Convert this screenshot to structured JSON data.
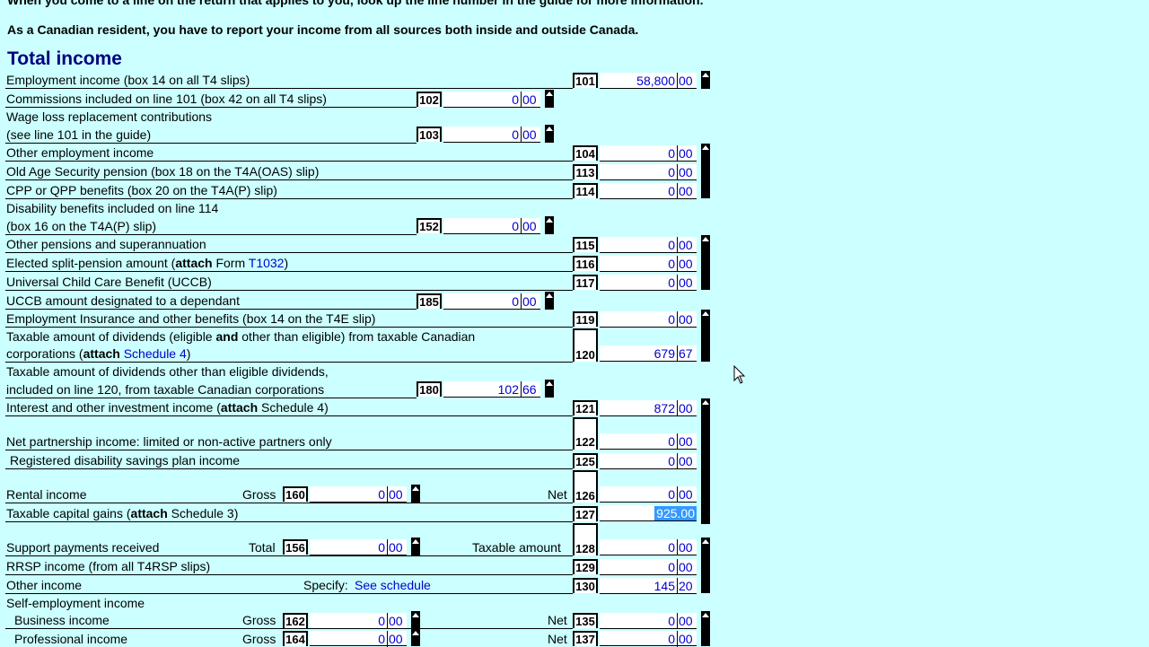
{
  "instructions": {
    "top_partial": "When you come to a line on the return that applies to you, look up the line number in the guide for more information.",
    "resident_note": "As a Canadian resident, you have to report your income from all sources both inside and outside Canada."
  },
  "section_title": "Total income",
  "rows": {
    "r101": {
      "label": "Employment income (box 14 on all T4 slips)",
      "line": "101",
      "dollars": "58,800",
      "cents": "00"
    },
    "r102": {
      "label": "Commissions included on line 101 (box 42 on all T4 slips)",
      "line": "102",
      "dollars": "0",
      "cents": "00"
    },
    "r103": {
      "label1": "Wage loss replacement contributions",
      "label2": "(see line 101 in the guide)",
      "line": "103",
      "dollars": "0",
      "cents": "00"
    },
    "r104": {
      "label": "Other employment income",
      "line": "104",
      "dollars": "0",
      "cents": "00"
    },
    "r113": {
      "label": "Old Age Security pension (box 18 on the T4A(OAS) slip)",
      "line": "113",
      "dollars": "0",
      "cents": "00"
    },
    "r114": {
      "label": "CPP or QPP benefits (box 20 on the T4A(P) slip)",
      "line": "114",
      "dollars": "0",
      "cents": "00"
    },
    "r152": {
      "label1": "Disability benefits included on line 114",
      "label2": "(box 16 on the T4A(P) slip)",
      "line": "152",
      "dollars": "0",
      "cents": "00"
    },
    "r115": {
      "label": "Other pensions and superannuation",
      "line": "115",
      "dollars": "0",
      "cents": "00"
    },
    "r116": {
      "label_pre": "Elected split-pension amount (",
      "label_bold": "attach",
      "label_mid": " Form ",
      "label_link": "T1032",
      "label_post": ")",
      "line": "116",
      "dollars": "0",
      "cents": "00"
    },
    "r117": {
      "label": "Universal Child Care Benefit (UCCB)",
      "line": "117",
      "dollars": "0",
      "cents": "00"
    },
    "r185": {
      "label": "UCCB amount designated to a dependant",
      "line": "185",
      "dollars": "0",
      "cents": "00"
    },
    "r119": {
      "label": "Employment Insurance and other benefits (box 14 on the T4E slip)",
      "line": "119",
      "dollars": "0",
      "cents": "00"
    },
    "r120": {
      "label1_pre": "Taxable amount of dividends (eligible ",
      "label1_bold": "and",
      "label1_post": " other than eligible) from taxable Canadian",
      "label2_pre": "corporations (",
      "label2_bold": "attach",
      "label2_link": " Schedule 4",
      "label2_post": ")",
      "line": "120",
      "dollars": "679",
      "cents": "67"
    },
    "r180": {
      "label1": "Taxable amount of dividends other than eligible dividends,",
      "label2": "included on line 120, from taxable Canadian corporations",
      "line": "180",
      "dollars": "102",
      "cents": "66"
    },
    "r121": {
      "label_pre": "Interest and other investment income (",
      "label_bold": "attach",
      "label_post": " Schedule 4)",
      "line": "121",
      "dollars": "872",
      "cents": "00"
    },
    "r122": {
      "label": "Net partnership income: limited or non-active partners only",
      "line": "122",
      "dollars": "0",
      "cents": "00"
    },
    "r125": {
      "label": "Registered disability savings plan income",
      "line": "125",
      "dollars": "0",
      "cents": "00"
    },
    "r126": {
      "label": "Rental income",
      "gross_label": "Gross",
      "gross_line": "160",
      "gross_dollars": "0",
      "gross_cents": "00",
      "net_label": "Net",
      "line": "126",
      "dollars": "0",
      "cents": "00"
    },
    "r127": {
      "label_pre": "Taxable capital gains (",
      "label_bold": "attach",
      "label_post": " Schedule 3)",
      "line": "127",
      "selected_value": "925.00"
    },
    "r128": {
      "label": "Support payments received",
      "total_label": "Total",
      "total_line": "156",
      "total_dollars": "0",
      "total_cents": "00",
      "taxable_label": "Taxable amount",
      "line": "128",
      "dollars": "0",
      "cents": "00"
    },
    "r129": {
      "label": "RRSP income (from all T4RSP slips)",
      "line": "129",
      "dollars": "0",
      "cents": "00"
    },
    "r130": {
      "label": "Other income",
      "specify_label": "Specify:",
      "specify_value": "See schedule",
      "line": "130",
      "dollars": "145",
      "cents": "20"
    },
    "self_emp": {
      "label": "Self-employment income"
    },
    "r135": {
      "label": "Business income",
      "gross_label": "Gross",
      "gross_line": "162",
      "gross_dollars": "0",
      "gross_cents": "00",
      "net_label": "Net",
      "line": "135",
      "dollars": "0",
      "cents": "00"
    },
    "r137": {
      "label": "Professional income",
      "gross_label": "Gross",
      "gross_line": "164",
      "gross_dollars": "0",
      "gross_cents": "00",
      "net_label": "Net",
      "line": "137",
      "dollars": "0",
      "cents": "00"
    }
  },
  "colors": {
    "background": "#ccffff",
    "heading": "#000080",
    "value_text": "#0000cc",
    "selection": "#3399ff"
  },
  "icons": {
    "spinner": "spin-up-icon",
    "cursor": "mouse-pointer-icon"
  }
}
